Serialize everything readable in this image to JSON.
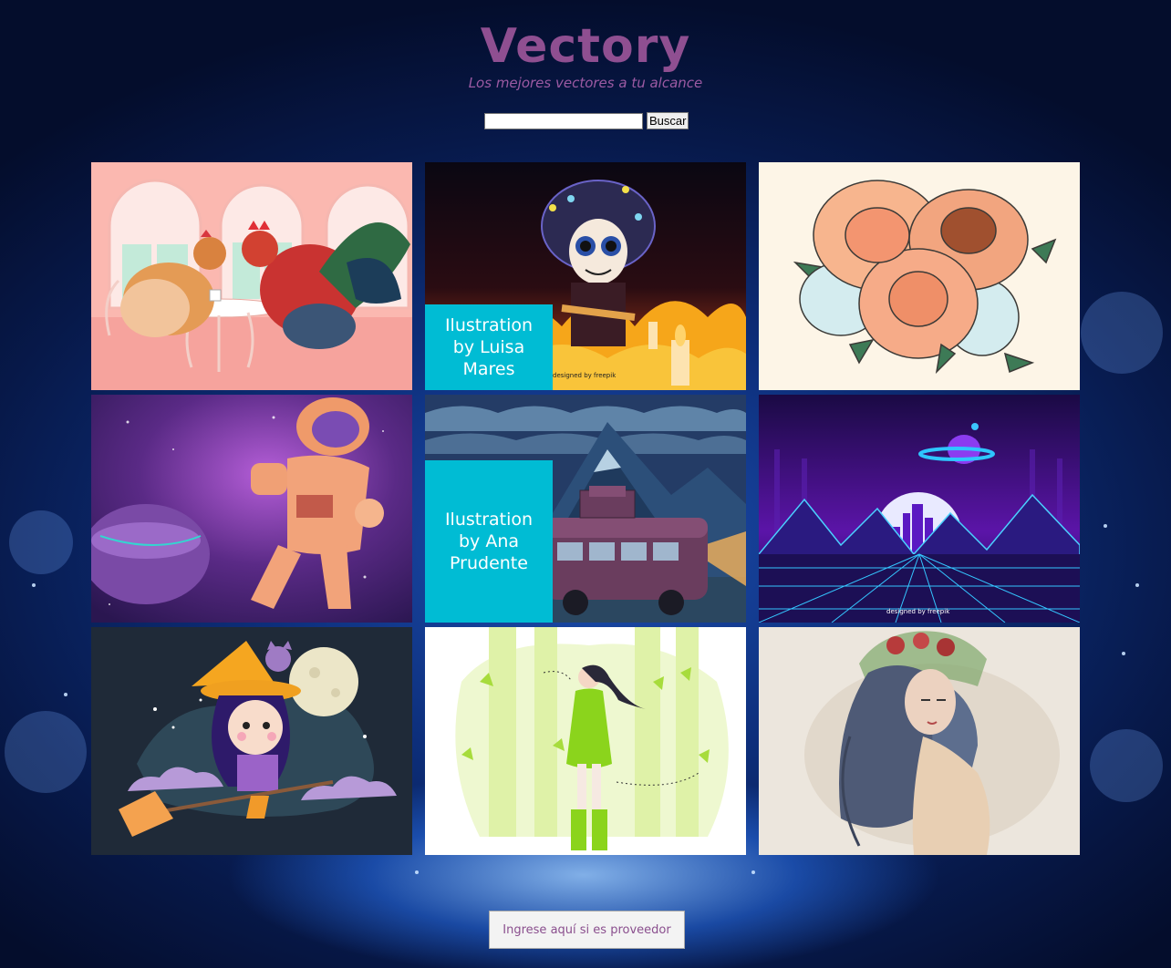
{
  "header": {
    "logo": "Vectory",
    "tagline": "Los mejores vectores a tu alcance"
  },
  "search": {
    "value": "",
    "button_label": "Buscar"
  },
  "gallery": {
    "items": [
      {
        "subject": "chickens-at-cafe-table",
        "caption": ""
      },
      {
        "subject": "day-of-the-dead-skeleton",
        "caption": "Ilustration by Luisa Mares"
      },
      {
        "subject": "peony-flower-bouquet",
        "caption": ""
      },
      {
        "subject": "astronaut-thumbs-up",
        "caption": ""
      },
      {
        "subject": "van-in-mountains",
        "caption": "Ilustration by Ana Prudente"
      },
      {
        "subject": "retro-neon-city",
        "caption": ""
      },
      {
        "subject": "witch-on-broom",
        "caption": ""
      },
      {
        "subject": "woman-in-green-forest",
        "caption": ""
      },
      {
        "subject": "watercolor-woman-portrait",
        "caption": ""
      }
    ]
  },
  "footer": {
    "provider_button_label": "Ingrese aquí si es proveedor"
  },
  "colors": {
    "brand": "#8f4f91",
    "caption_bg": "#00bcd4",
    "background": "#0d2f7c"
  }
}
